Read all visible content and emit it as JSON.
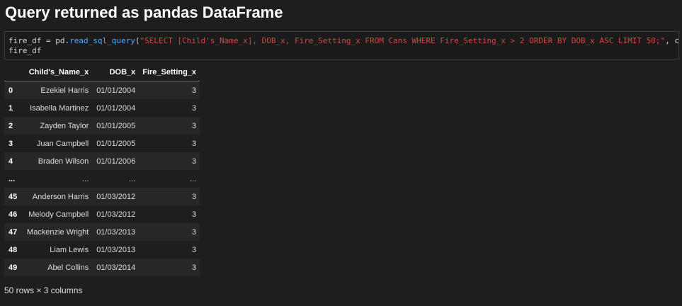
{
  "heading": "Query returned as pandas DataFrame",
  "code": {
    "var": "fire_df",
    "assign": " = ",
    "module": "pd.",
    "function": "read_sql_query",
    "open_paren": "(",
    "query": "\"SELECT [Child's_Name_x], DOB_x, Fire_Setting_x FROM Cans WHERE Fire_Setting_x > 2 ORDER BY DOB_x ASC LIMIT 50;\"",
    "tail": ", conn)",
    "line2": "fire_df"
  },
  "table": {
    "index_header": "",
    "columns": [
      "Child's_Name_x",
      "DOB_x",
      "Fire_Setting_x"
    ],
    "rows": [
      {
        "index": "0",
        "name": "Ezekiel Harris",
        "dob": "01/01/2004",
        "fire": "3"
      },
      {
        "index": "1",
        "name": "Isabella Martinez",
        "dob": "01/01/2004",
        "fire": "3"
      },
      {
        "index": "2",
        "name": "Zayden Taylor",
        "dob": "01/01/2005",
        "fire": "3"
      },
      {
        "index": "3",
        "name": "Juan Campbell",
        "dob": "01/01/2005",
        "fire": "3"
      },
      {
        "index": "4",
        "name": "Braden Wilson",
        "dob": "01/01/2006",
        "fire": "3"
      },
      {
        "index": "...",
        "name": "...",
        "dob": "...",
        "fire": "..."
      },
      {
        "index": "45",
        "name": "Anderson Harris",
        "dob": "01/03/2012",
        "fire": "3"
      },
      {
        "index": "46",
        "name": "Melody Campbell",
        "dob": "01/03/2012",
        "fire": "3"
      },
      {
        "index": "47",
        "name": "Mackenzie Wright",
        "dob": "01/03/2013",
        "fire": "3"
      },
      {
        "index": "48",
        "name": "Liam Lewis",
        "dob": "01/03/2013",
        "fire": "3"
      },
      {
        "index": "49",
        "name": "Abel Collins",
        "dob": "01/03/2014",
        "fire": "3"
      }
    ]
  },
  "shape_note": "50 rows × 3 columns",
  "colors": {
    "background": "#1e1e1e",
    "function": "#4fa9ff",
    "string": "#ce4a43",
    "row_stripe": "#272727"
  }
}
